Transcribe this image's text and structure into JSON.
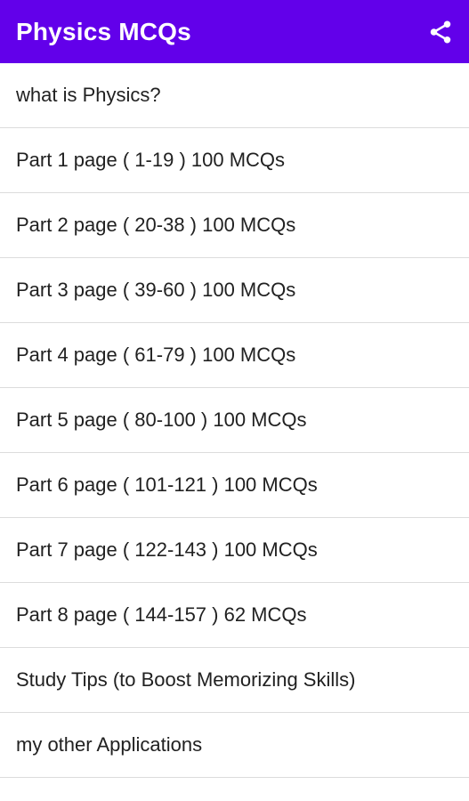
{
  "app_bar": {
    "title": "Physics MCQs",
    "share_icon": "share-icon",
    "background": "#6200ea"
  },
  "list": {
    "items": [
      {
        "label": "what is Physics?"
      },
      {
        "label": "Part 1 page ( 1-19 ) 100 MCQs"
      },
      {
        "label": "Part 2 page ( 20-38 ) 100 MCQs"
      },
      {
        "label": "Part 3 page ( 39-60 ) 100 MCQs"
      },
      {
        "label": "Part 4 page ( 61-79 ) 100 MCQs"
      },
      {
        "label": "Part 5 page ( 80-100 ) 100 MCQs"
      },
      {
        "label": "Part 6 page ( 101-121 ) 100 MCQs"
      },
      {
        "label": "Part 7 page ( 122-143 ) 100 MCQs"
      },
      {
        "label": "Part 8 page ( 144-157 ) 62 MCQs"
      },
      {
        "label": "Study Tips (to Boost Memorizing Skills)"
      },
      {
        "label": "my other Applications"
      }
    ]
  }
}
